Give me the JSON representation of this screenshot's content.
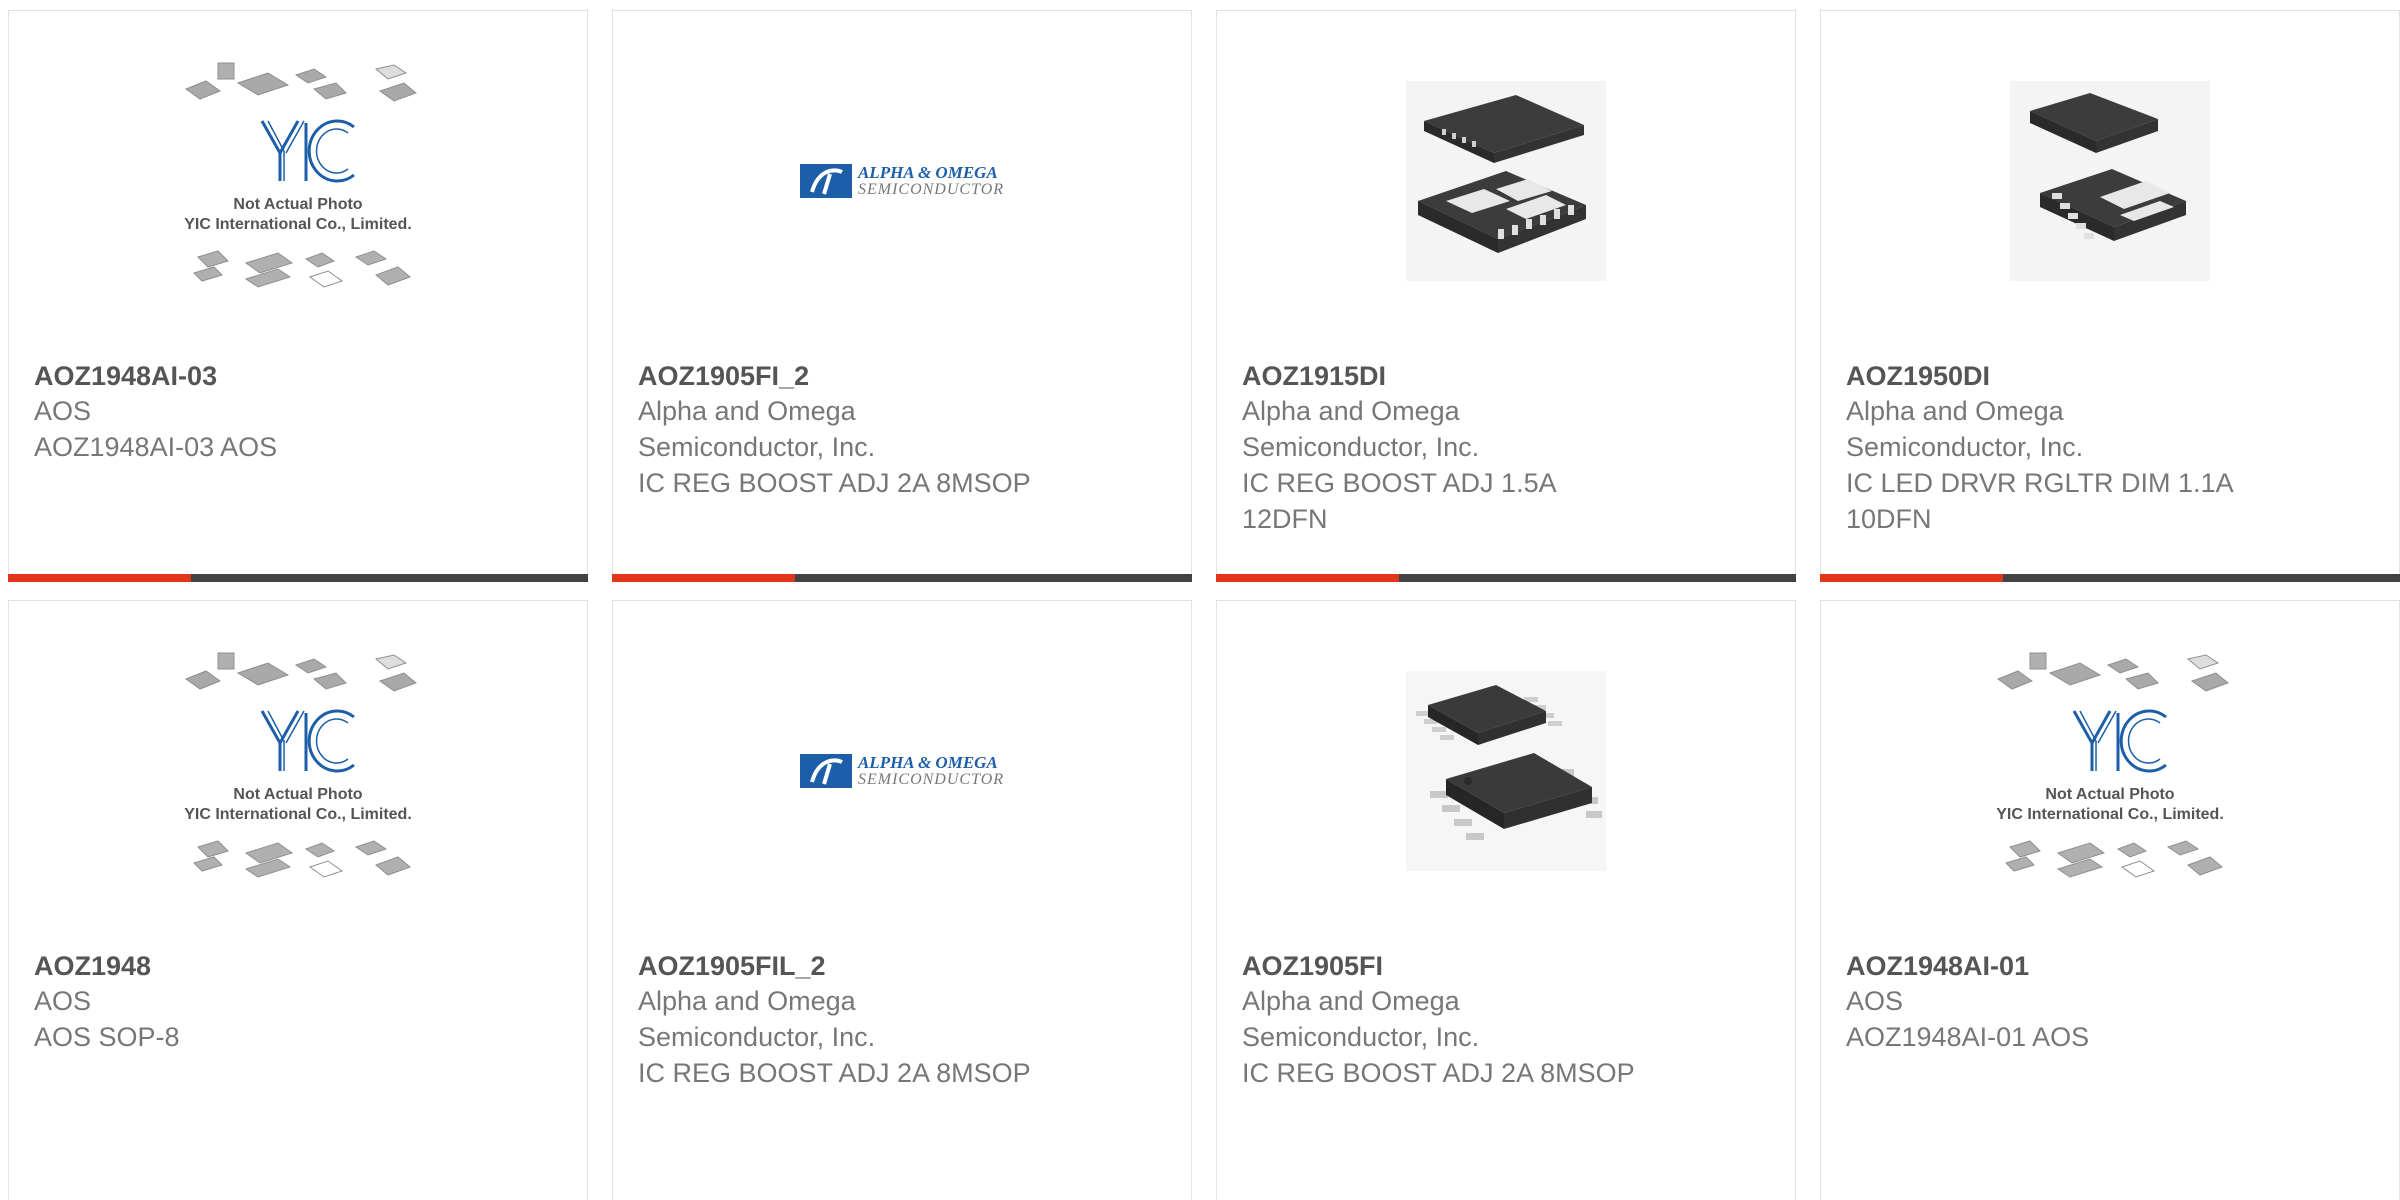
{
  "brand_colors": {
    "accent": "#e0361a",
    "bar": "#424242",
    "logo_blue": "#1d5ea8"
  },
  "placeholder": {
    "line1": "Not Actual Photo",
    "line2": "YIC International Co., Limited."
  },
  "aos_logo": {
    "line1": "ALPHA & OMEGA",
    "line2": "SEMICONDUCTOR"
  },
  "products": [
    {
      "part": "AOZ1948AI-03",
      "manufacturer": "AOS",
      "description": "AOZ1948AI-03 AOS",
      "image": "placeholder"
    },
    {
      "part": "AOZ1905FI_2",
      "manufacturer": "Alpha and Omega Semiconductor, Inc.",
      "description": "IC REG BOOST ADJ 2A 8MSOP",
      "image": "aos-logo"
    },
    {
      "part": "AOZ1915DI",
      "manufacturer": "Alpha and Omega Semiconductor, Inc.",
      "description": "IC REG BOOST ADJ 1.5A 12DFN",
      "image": "dfn-12"
    },
    {
      "part": "AOZ1950DI",
      "manufacturer": "Alpha and Omega Semiconductor, Inc.",
      "description": "IC LED DRVR RGLTR DIM 1.1A 10DFN",
      "image": "dfn-10"
    },
    {
      "part": "AOZ1948",
      "manufacturer": "AOS",
      "description": "AOS SOP-8",
      "image": "placeholder"
    },
    {
      "part": "AOZ1905FIL_2",
      "manufacturer": "Alpha and Omega Semiconductor, Inc.",
      "description": "IC REG BOOST ADJ 2A 8MSOP",
      "image": "aos-logo"
    },
    {
      "part": "AOZ1905FI",
      "manufacturer": "Alpha and Omega Semiconductor, Inc.",
      "description": "IC REG BOOST ADJ 2A 8MSOP",
      "image": "msop-8"
    },
    {
      "part": "AOZ1948AI-01",
      "manufacturer": "AOS",
      "description": "AOZ1948AI-01 AOS",
      "image": "placeholder"
    }
  ]
}
